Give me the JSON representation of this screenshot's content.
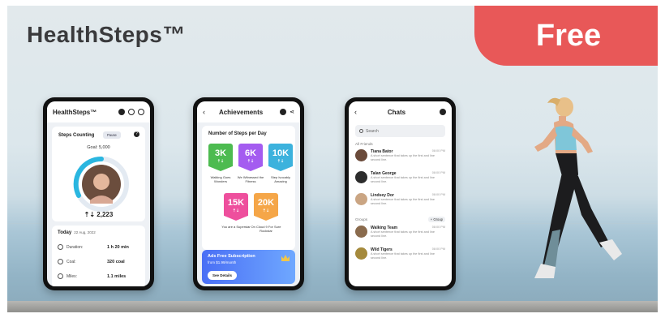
{
  "brand": {
    "name": "HealthSteps™"
  },
  "badge": {
    "label": "Free"
  },
  "phone1": {
    "app_title": "HealthSteps™",
    "steps_card": {
      "title": "Steps Counting",
      "pause_label": "Pause",
      "hint": "?",
      "goal": "Goal: 5,000",
      "steps": "⇡⇣ 2,223"
    },
    "today": {
      "label": "Today",
      "date": "22 Aug, 2022",
      "rows": [
        {
          "label": "Duration:",
          "value": "1 h 20 min"
        },
        {
          "label": "Coal:",
          "value": "320 coal"
        },
        {
          "label": "Miles:",
          "value": "1.1 miles"
        }
      ]
    }
  },
  "phone2": {
    "title": "Achievements",
    "section": "Number of Steps per Day",
    "badges": [
      {
        "value": "3K",
        "caption": "Walking Goes Wonders",
        "color": "#4dbb50"
      },
      {
        "value": "6K",
        "caption": "We Witnessed the Fitness",
        "color": "#a45cf0"
      },
      {
        "value": "10K",
        "caption": "Step Ivocably Amazing",
        "color": "#3cb2dd"
      },
      {
        "value": "15K",
        "caption": "You are a Superstar",
        "color": "#ee4f9d"
      },
      {
        "value": "20K",
        "caption": "On Cloud 9 For Sure Rockstar",
        "color": "#f5a648"
      }
    ],
    "promo": {
      "title": "Ads Free Subscription",
      "price": "from $1.99/month",
      "button": "See Details"
    }
  },
  "phone3": {
    "title": "Chats",
    "search_placeholder": "Search",
    "friends_label": "All Friends",
    "groups_label": "Groups",
    "add_group": "+ Group",
    "chats": [
      {
        "name": "Tiana Bator",
        "time": "08:00 PM",
        "message": "A short sentence that takes up the first and line second line."
      },
      {
        "name": "Talan George",
        "time": "08:00 PM",
        "message": "A short sentence that takes up the first and line second line."
      },
      {
        "name": "Lindsey Dor",
        "time": "08:00 PM",
        "message": "A short sentence that takes up the first and line second line."
      }
    ],
    "groups": [
      {
        "name": "Walking Team",
        "time": "08:00 PM",
        "message": "A short sentence that takes up the first and line second line."
      },
      {
        "name": "Wild Tigers",
        "time": "08:00 PM",
        "message": "A short sentence that takes up the first and line second line."
      }
    ]
  }
}
